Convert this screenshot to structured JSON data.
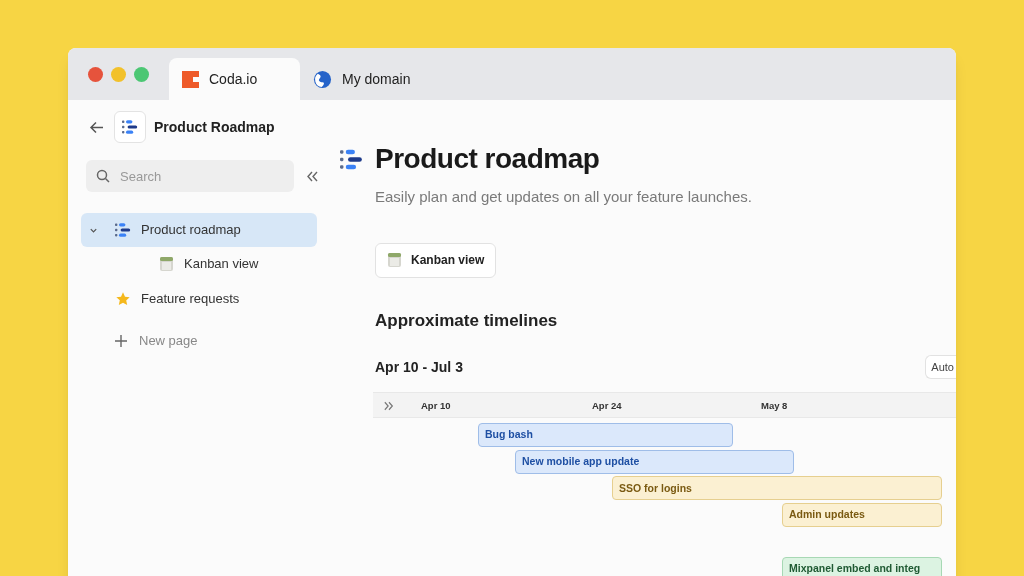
{
  "tabs": [
    {
      "label": "Coda.io",
      "selected": true,
      "kind": "coda"
    },
    {
      "label": "My domain",
      "selected": false,
      "kind": "globe"
    }
  ],
  "sidebar": {
    "doc_title": "Product Roadmap",
    "search": {
      "placeholder": "Search"
    },
    "items": [
      {
        "label": "Product roadmap",
        "kind": "roadmap",
        "selected": true,
        "expanded": true,
        "children": [
          {
            "label": "Kanban view",
            "kind": "kanban",
            "selected": false
          }
        ]
      },
      {
        "label": "Feature requests",
        "kind": "star",
        "selected": false
      }
    ],
    "new_page": "New page"
  },
  "page": {
    "title": "Product roadmap",
    "subtitle": "Easily plan and get updates on all your feature launches.",
    "view_button": "Kanban view",
    "section_title": "Approximate timelines",
    "timeline": {
      "range": "Apr 10 - Jul 3",
      "mode_button": "Auto",
      "dates": [
        "Apr 10",
        "Apr 24",
        "May 8"
      ],
      "bars": [
        {
          "label": "Bug bash",
          "color": "#dbe8fb"
        },
        {
          "label": "New mobile app update",
          "color": "#dbe8fb"
        },
        {
          "label": "SSO for logins",
          "color": "#fbf0d2"
        },
        {
          "label": "Admin updates",
          "color": "#fbf0d2"
        },
        {
          "label": "Mixpanel embed and integ",
          "color": "#dcf3e2"
        }
      ]
    }
  }
}
